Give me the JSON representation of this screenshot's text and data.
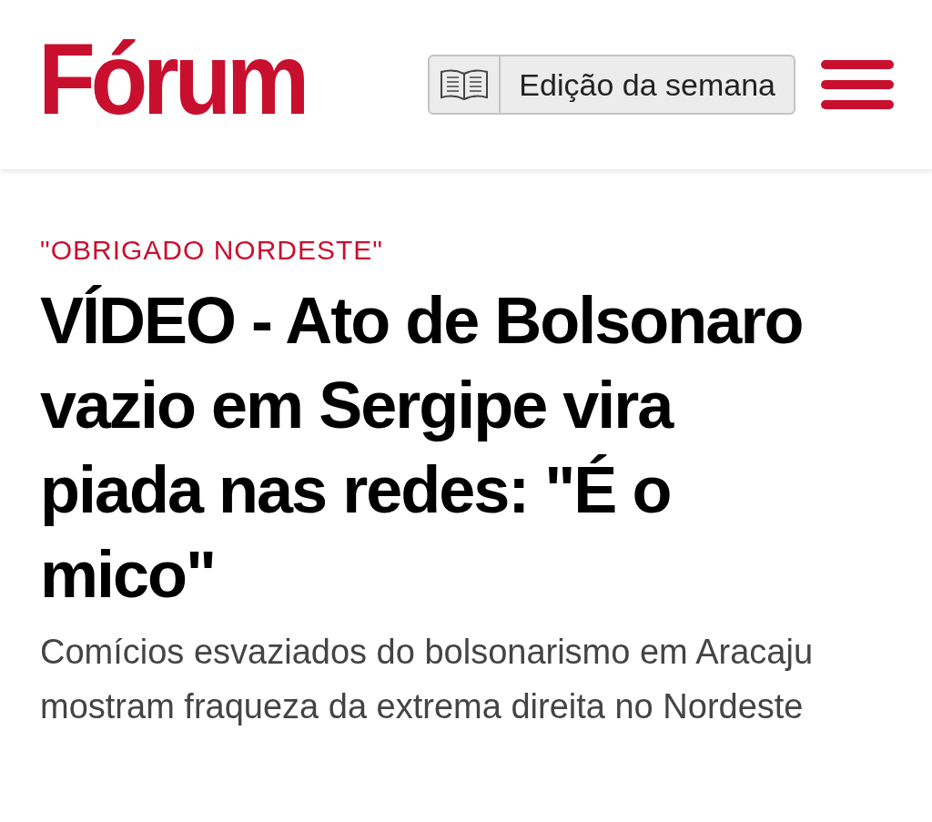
{
  "header": {
    "logo": "Fórum",
    "edition_button": {
      "label": "Edição da semana"
    }
  },
  "article": {
    "kicker": "\"OBRIGADO NORDESTE\"",
    "headline": "VÍDEO - Ato de Bolsonaro vazio em Sergipe vira piada nas redes: \"É o mico\"",
    "subtitle": "Comícios esvaziados do bolsonarismo em Aracaju mostram fraqueza da extrema direita no Nordeste"
  }
}
